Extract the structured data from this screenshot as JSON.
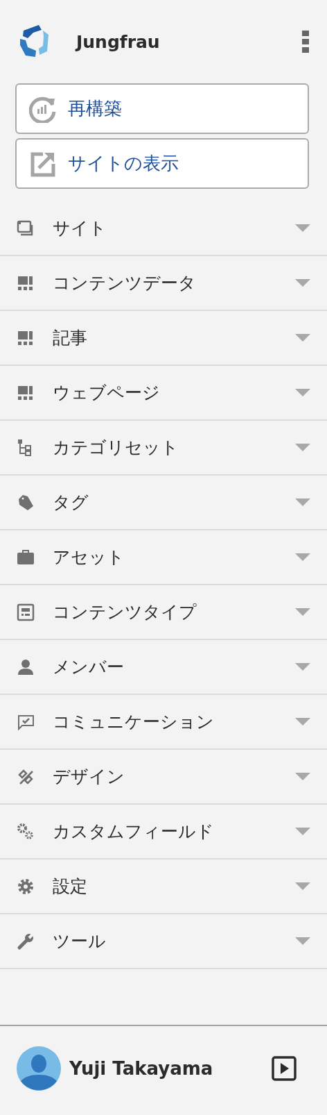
{
  "header": {
    "title": "Jungfrau"
  },
  "actions": [
    {
      "kind": "rebuild",
      "label": "再構築"
    },
    {
      "kind": "view",
      "label": "サイトの表示"
    }
  ],
  "menu": [
    {
      "kind": "site",
      "label": "サイト"
    },
    {
      "kind": "content",
      "label": "コンテンツデータ"
    },
    {
      "kind": "content",
      "label": "記事"
    },
    {
      "kind": "content",
      "label": "ウェブページ"
    },
    {
      "kind": "category",
      "label": "カテゴリセット"
    },
    {
      "kind": "tag",
      "label": "タグ"
    },
    {
      "kind": "asset",
      "label": "アセット"
    },
    {
      "kind": "contenttype",
      "label": "コンテンツタイプ"
    },
    {
      "kind": "member",
      "label": "メンバー"
    },
    {
      "kind": "communication",
      "label": "コミュニケーション"
    },
    {
      "kind": "design",
      "label": "デザイン"
    },
    {
      "kind": "customfield",
      "label": "カスタムフィールド"
    },
    {
      "kind": "settings",
      "label": "設定"
    },
    {
      "kind": "tools",
      "label": "ツール"
    }
  ],
  "user": {
    "name": "Yuji Takayama"
  }
}
